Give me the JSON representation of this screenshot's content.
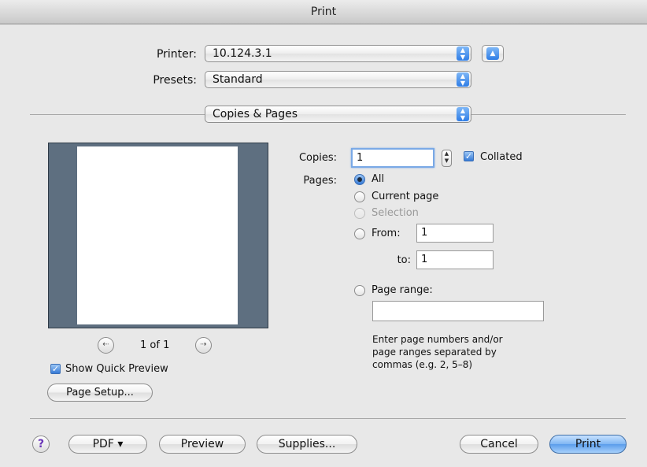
{
  "window": {
    "title": "Print"
  },
  "printer": {
    "label": "Printer:",
    "value": "10.124.3.1"
  },
  "presets": {
    "label": "Presets:",
    "value": "Standard"
  },
  "section": {
    "value": "Copies & Pages"
  },
  "preview": {
    "page_indicator": "1 of 1",
    "show_quick_preview": "Show Quick Preview",
    "page_setup": "Page Setup..."
  },
  "copies": {
    "label": "Copies:",
    "value": "1",
    "collated": "Collated"
  },
  "pages": {
    "label": "Pages:",
    "all": "All",
    "current": "Current page",
    "selection": "Selection",
    "from": "From:",
    "from_value": "1",
    "to": "to:",
    "to_value": "1",
    "range": "Page range:",
    "range_value": "",
    "hint_line1": "Enter page numbers and/or",
    "hint_line2": "page ranges separated by",
    "hint_line3": "commas (e.g. 2, 5–8)"
  },
  "footer": {
    "help": "?",
    "pdf": "PDF ▾",
    "preview": "Preview",
    "supplies": "Supplies...",
    "cancel": "Cancel",
    "print": "Print"
  },
  "colors": {
    "accent": "#3579d6",
    "preview_bg": "#5e6f80",
    "window_bg": "#e8e8e8"
  }
}
